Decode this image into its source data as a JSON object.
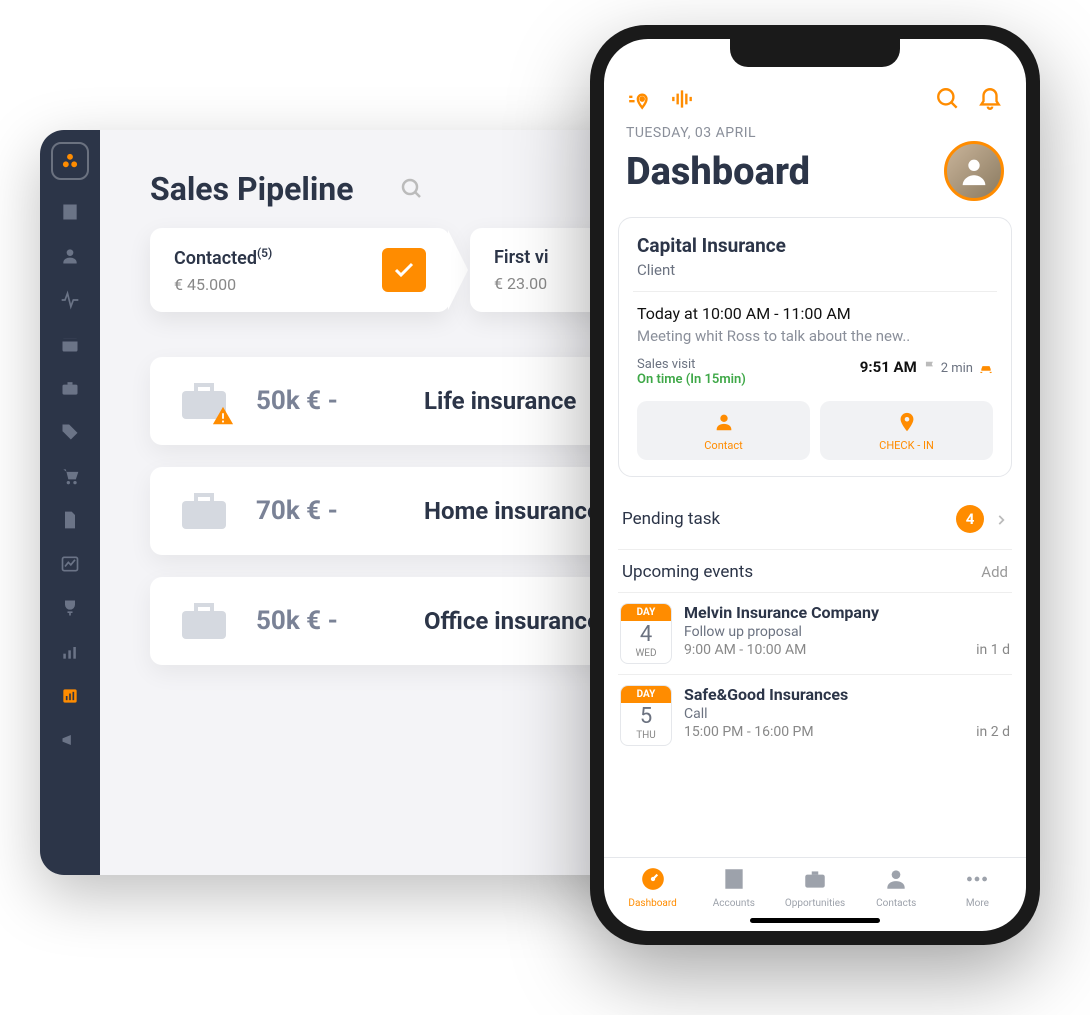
{
  "desktop": {
    "pipeline_title": "Sales Pipeline",
    "stages": [
      {
        "name": "Contacted",
        "count": "(5)",
        "amount": "€ 45.000"
      },
      {
        "name": "First vi",
        "count": "",
        "amount": "€ 23.00"
      }
    ],
    "opportunities": [
      {
        "amount": "50k € -",
        "name": "Life insurance",
        "warning": true
      },
      {
        "amount": "70k € -",
        "name": "Home insurance",
        "warning": false
      },
      {
        "amount": "50k € -",
        "name": "Office insurance",
        "warning": false
      }
    ]
  },
  "phone": {
    "date_label": "TUESDAY, 03 APRIL",
    "title": "Dashboard",
    "meeting_card": {
      "company": "Capital Insurance",
      "type": "Client",
      "when": "Today at 10:00 AM - 11:00 AM",
      "desc": "Meeting whit Ross to talk about the new..",
      "visit_label": "Sales visit",
      "ontime": "On time (In 15min)",
      "time_right_1": "9:51 AM",
      "time_right_2": "2 min",
      "btn_contact": "Contact",
      "btn_checkin": "CHECK - IN"
    },
    "pending_task": {
      "label": "Pending task",
      "count": "4"
    },
    "upcoming": {
      "title": "Upcoming events",
      "add_label": "Add",
      "events": [
        {
          "day_label": "DAY",
          "day": "4",
          "dow": "WED",
          "title": "Melvin Insurance Company",
          "sub": "Follow up proposal",
          "time": "9:00 AM - 10:00 AM",
          "rel": "in 1 d"
        },
        {
          "day_label": "DAY",
          "day": "5",
          "dow": "THU",
          "title": "Safe&Good Insurances",
          "sub": "Call",
          "time": "15:00 PM - 16:00 PM",
          "rel": "in 2 d"
        }
      ]
    },
    "tabs": [
      {
        "label": "Dashboard"
      },
      {
        "label": "Accounts"
      },
      {
        "label": "Opportunities"
      },
      {
        "label": "Contacts"
      },
      {
        "label": "More"
      }
    ]
  }
}
